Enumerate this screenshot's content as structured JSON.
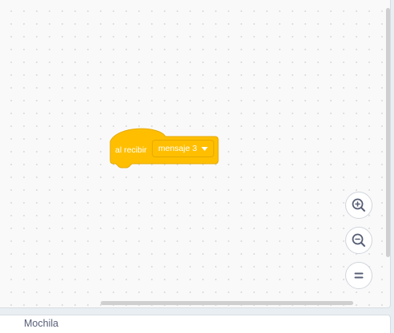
{
  "workspace": {
    "hat_block": {
      "label": "al recibir",
      "message_value": "mensaje 3",
      "color": "#ffbf00"
    }
  },
  "zoom_controls": {
    "zoom_in_icon": "zoom-in-icon",
    "zoom_out_icon": "zoom-out-icon",
    "reset_icon": "equals-icon"
  },
  "backpack": {
    "label": "Mochila"
  }
}
